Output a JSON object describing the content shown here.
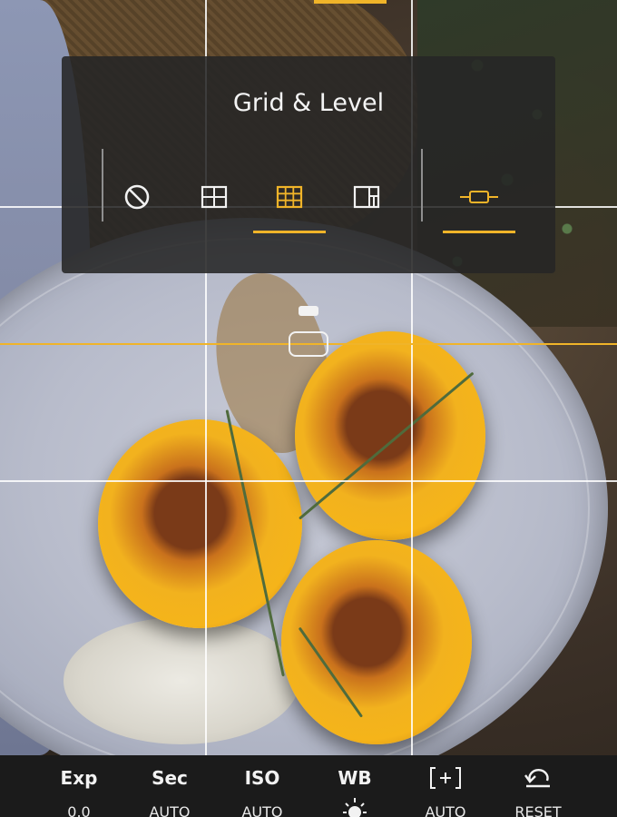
{
  "popup": {
    "title": "Grid & Level",
    "options": [
      {
        "name": "none",
        "icon": "no-grid-icon",
        "selected": false
      },
      {
        "name": "2x2",
        "icon": "grid-2x2-icon",
        "selected": false
      },
      {
        "name": "3x3",
        "icon": "grid-3x3-icon",
        "selected": true
      },
      {
        "name": "golden",
        "icon": "golden-ratio-grid-icon",
        "selected": false
      }
    ],
    "level": {
      "icon": "level-icon",
      "selected": true
    }
  },
  "toolbar": {
    "items": [
      {
        "label": "Exp",
        "value": "0.0"
      },
      {
        "label": "Sec",
        "value": "AUTO"
      },
      {
        "label": "ISO",
        "value": "AUTO"
      },
      {
        "label": "WB",
        "icon": "sun-icon"
      },
      {
        "icon": "focus-bracket-plus-icon",
        "value": "AUTO"
      },
      {
        "icon": "reset-arrow-icon",
        "value": "RESET"
      }
    ]
  },
  "colors": {
    "accent": "#f0b429",
    "popup_bg": "#262626",
    "toolbar_bg": "#1b1b1b",
    "text": "#f4f4f4"
  }
}
